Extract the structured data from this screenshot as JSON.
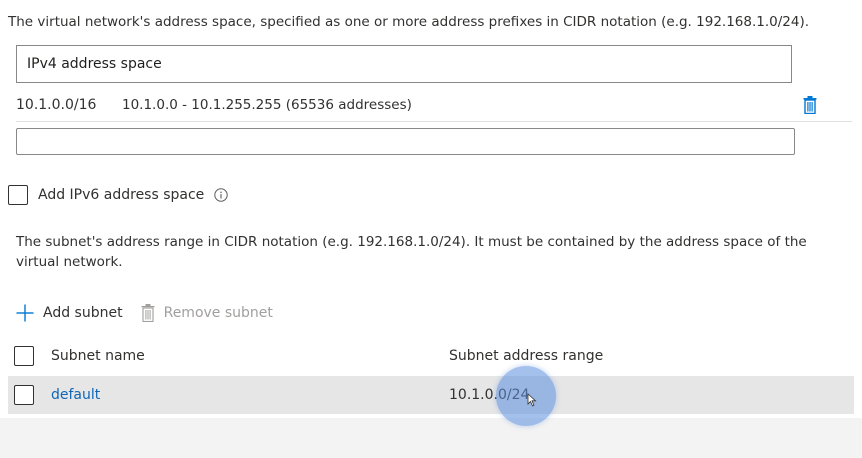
{
  "address_space": {
    "description": "The virtual network's address space, specified as one or more address prefixes in CIDR notation (e.g. 192.168.1.0/24).",
    "ipv4_header": "IPv4 address space",
    "entries": [
      {
        "prefix": "10.1.0.0/16",
        "range": "10.1.0.0 - 10.1.255.255 (65536 addresses)"
      }
    ],
    "new_entry_value": ""
  },
  "ipv6": {
    "label": "Add IPv6 address space",
    "checked": false
  },
  "subnets": {
    "description": "The subnet's address range in CIDR notation (e.g. 192.168.1.0/24). It must be contained by the address space of the virtual network.",
    "add_label": "Add subnet",
    "remove_label": "Remove subnet",
    "columns": {
      "name": "Subnet name",
      "range": "Subnet address range"
    },
    "rows": [
      {
        "name": "default",
        "range": "10.1.0.0/24"
      }
    ]
  },
  "colors": {
    "link": "#1066b5",
    "accent": "#0078d4",
    "disabled": "#a19f9d",
    "selected_row": "#e6e6e6"
  },
  "icons": [
    "delete-icon",
    "info-icon",
    "add-icon",
    "remove-icon",
    "pointer-cursor-icon"
  ]
}
